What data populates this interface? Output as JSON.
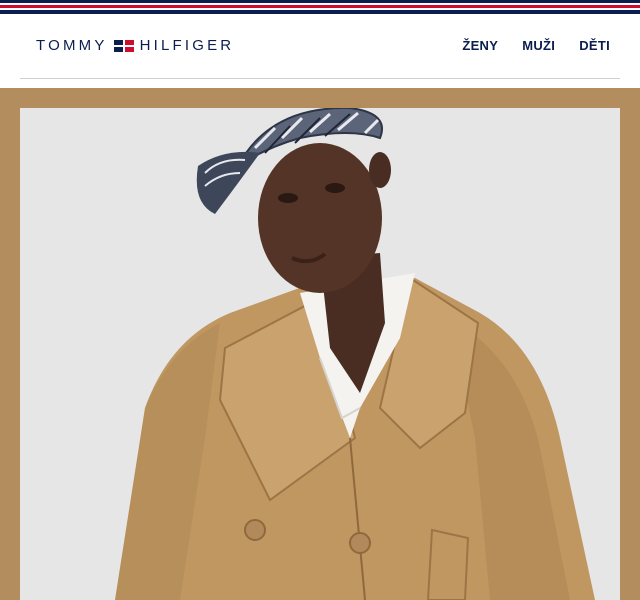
{
  "brand": {
    "name_left": "TOMMY",
    "name_right": "HILFIGER",
    "colors": {
      "navy": "#0b1e4f",
      "red": "#cc0d2f",
      "white": "#ffffff"
    }
  },
  "nav": {
    "items": [
      {
        "label": "ŽENY"
      },
      {
        "label": "MUŽI"
      },
      {
        "label": "DĚTI"
      }
    ]
  },
  "hero": {
    "frame_color": "#b48d5f",
    "background_color": "#e6e6e6",
    "image": "model-in-camel-coat-and-monogram-cap"
  }
}
